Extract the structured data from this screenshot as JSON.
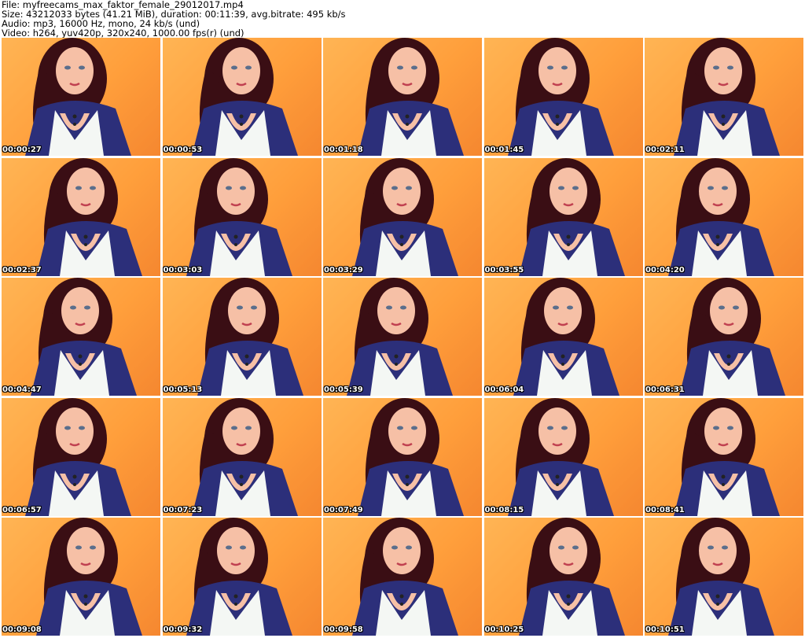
{
  "header": {
    "file_line": "File: myfreecams_max_faktor_female_29012017.mp4",
    "size_line": "Size: 43212033 bytes (41.21 MiB), duration: 00:11:39, avg.bitrate: 495 kb/s",
    "audio_line": "Audio: mp3, 16000 Hz, mono, 24 kb/s (und)",
    "video_line": "Video: h264, yuv420p, 320x240, 1000.00 fps(r) (und)"
  },
  "thumbnails": [
    {
      "timestamp": "00:00:27"
    },
    {
      "timestamp": "00:00:53"
    },
    {
      "timestamp": "00:01:18"
    },
    {
      "timestamp": "00:01:45"
    },
    {
      "timestamp": "00:02:11"
    },
    {
      "timestamp": "00:02:37"
    },
    {
      "timestamp": "00:03:03"
    },
    {
      "timestamp": "00:03:29"
    },
    {
      "timestamp": "00:03:55"
    },
    {
      "timestamp": "00:04:20"
    },
    {
      "timestamp": "00:04:47"
    },
    {
      "timestamp": "00:05:13"
    },
    {
      "timestamp": "00:05:39"
    },
    {
      "timestamp": "00:06:04"
    },
    {
      "timestamp": "00:06:31"
    },
    {
      "timestamp": "00:06:57"
    },
    {
      "timestamp": "00:07:23"
    },
    {
      "timestamp": "00:07:49"
    },
    {
      "timestamp": "00:08:15"
    },
    {
      "timestamp": "00:08:41"
    },
    {
      "timestamp": "00:09:08"
    },
    {
      "timestamp": "00:09:32"
    },
    {
      "timestamp": "00:09:58"
    },
    {
      "timestamp": "00:10:25"
    },
    {
      "timestamp": "00:10:51"
    }
  ],
  "colors": {
    "background": "#ffffff",
    "header_text": "#000000",
    "wall": "#ffa040",
    "hair": "#3a0e14",
    "skin": "#f6c0a6",
    "dress_navy": "#2c2f7a",
    "dress_white": "#f4f7f4"
  }
}
